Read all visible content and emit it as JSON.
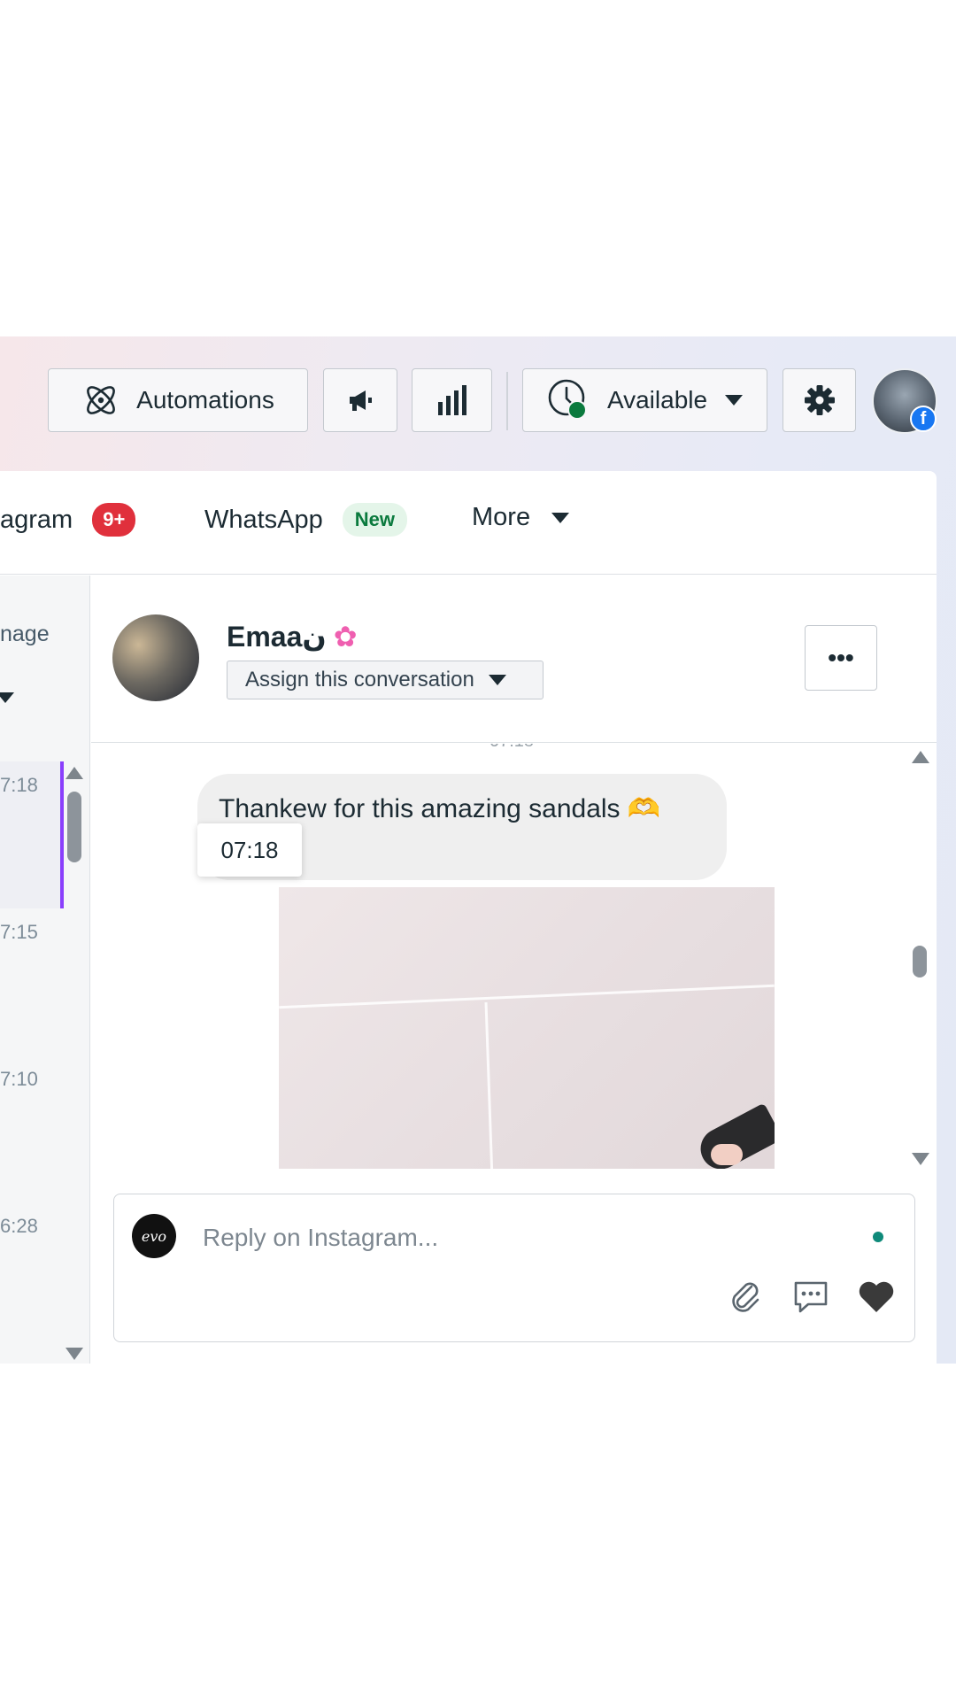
{
  "toolbar": {
    "automations_label": "Automations",
    "available_label": "Available"
  },
  "tabs": {
    "instagram_label": "agram",
    "instagram_badge": "9+",
    "whatsapp_label": "WhatsApp",
    "whatsapp_badge": "New",
    "more_label": "More"
  },
  "inbox_list": {
    "header_partial": "nage",
    "times": [
      "7:18",
      "7:15",
      "7:10",
      "6:28"
    ]
  },
  "conversation": {
    "contact_name": "Emaaن",
    "assign_label": "Assign this conversation",
    "more_label": "•••",
    "previous_time_partial": "07:18"
  },
  "messages": [
    {
      "text": "Thankew for this amazing sandals 🫶",
      "tooltip_time": "07:18"
    }
  ],
  "composer": {
    "placeholder": "Reply on Instagram...",
    "page_logo_text": "evo"
  },
  "colors": {
    "accent_purple": "#8a3ffc",
    "badge_red": "#e0303c",
    "badge_new_bg": "#e4f5e9",
    "badge_new_text": "#0b7a3e",
    "available_green": "#0b7a3e",
    "facebook_blue": "#1877f2"
  },
  "icons": [
    "automations-icon",
    "megaphone-icon",
    "insights-icon",
    "clock-status-icon",
    "caret-down-icon",
    "gear-icon",
    "facebook-badge-icon",
    "more-icon",
    "scroll-up-icon",
    "scroll-down-icon",
    "attachment-icon",
    "saved-replies-icon",
    "heart-icon"
  ]
}
